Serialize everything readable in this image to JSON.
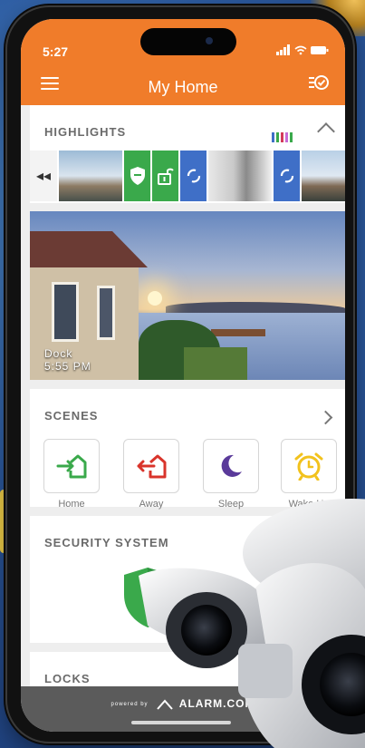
{
  "status_bar": {
    "time": "5:27",
    "icons": "signal-wifi-battery"
  },
  "header": {
    "title": "My Home",
    "menu_icon": "hamburger-menu-icon",
    "tasks_icon": "checklist-icon"
  },
  "highlights": {
    "label": "HIGHLIGHTS",
    "rewind_icon": "◂◂",
    "tiles": [
      {
        "kind": "camera-thumbnail"
      },
      {
        "kind": "security-armed",
        "color": "#3aa94b"
      },
      {
        "kind": "lock-unlocked",
        "color": "#3aa94b"
      },
      {
        "kind": "link-event",
        "color": "#3f6fc7"
      },
      {
        "kind": "camera-thumbnail"
      },
      {
        "kind": "link-event",
        "color": "#3f6fc7"
      },
      {
        "kind": "camera-thumbnail"
      }
    ],
    "legend_colors": [
      "#3f6fc7",
      "#3aa94b",
      "#d33a5a",
      "#c76bd6",
      "#3aa94b"
    ]
  },
  "camera_feed": {
    "name": "Dock",
    "time": "5:55 PM"
  },
  "scenes": {
    "label": "SCENES",
    "items": [
      {
        "label": "Home",
        "icon": "home-arrive-icon",
        "color": "#3aa94b"
      },
      {
        "label": "Away",
        "icon": "home-leave-icon",
        "color": "#d9342b"
      },
      {
        "label": "Sleep",
        "icon": "moon-icon",
        "color": "#5a3a9a"
      },
      {
        "label": "Wake Up",
        "icon": "alarm-clock-icon",
        "color": "#f2c21d"
      }
    ]
  },
  "security": {
    "label": "SECURITY SYSTEM",
    "icon": "shield-icon",
    "color": "#3aa94b"
  },
  "locks": {
    "label": "LOCKS"
  },
  "footer": {
    "powered_by": "powered by",
    "brand": "ALARM.COM"
  },
  "colors": {
    "header": "#f07c2a",
    "background": "#2c5aa0"
  }
}
